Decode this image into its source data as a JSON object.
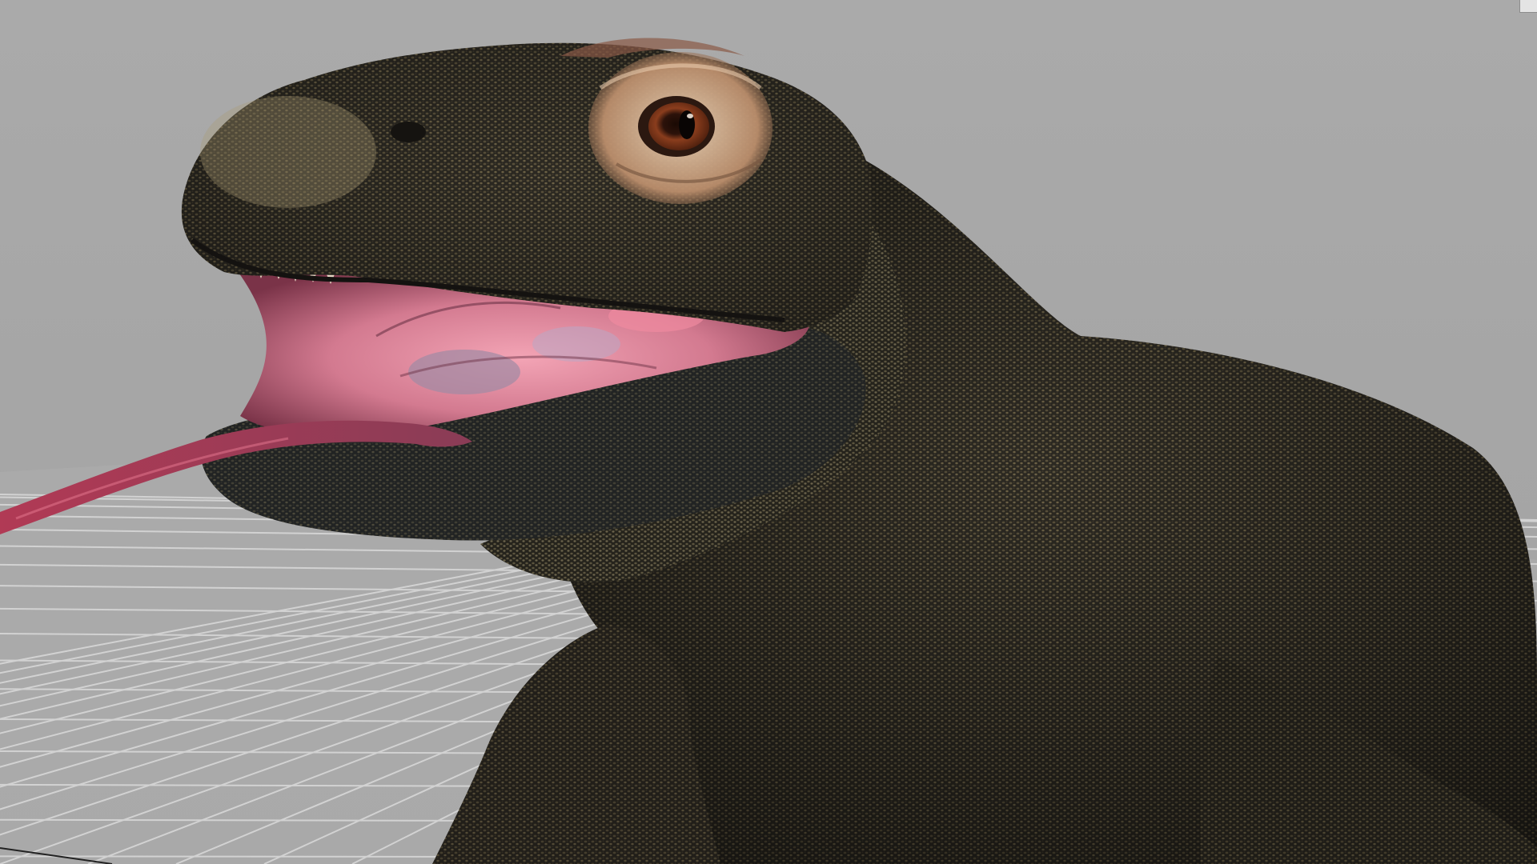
{
  "viewport": {
    "background": "#a8a8a8",
    "grid_line_color": "#d2d2d2",
    "grid_fill_color": "#aeaeae"
  },
  "model": {
    "skin_dark": "#2a2721",
    "skin_mid": "#4a4434",
    "skin_light": "#8a7d5e",
    "mouth_inside": "#d97a8e",
    "tongue": "#b0405a",
    "eye": "#6b2a12"
  },
  "icons": {
    "corner": "viewport-corner-handle-icon"
  }
}
